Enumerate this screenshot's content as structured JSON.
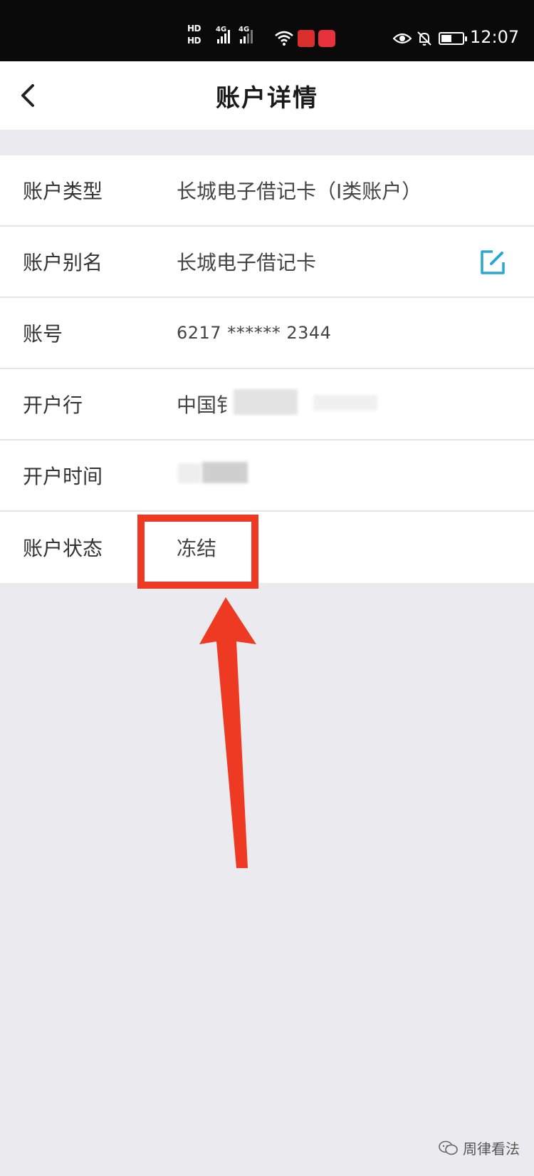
{
  "status_bar": {
    "network_label_1": "HD",
    "network_label_2": "HD",
    "signal_tag_1": "4G",
    "signal_tag_2": "4G",
    "time": "12:07"
  },
  "header": {
    "title": "账户详情",
    "back_icon": "chevron-left-icon"
  },
  "details": {
    "rows": [
      {
        "label": "账户类型",
        "value": "长城电子借记卡（I类账户）"
      },
      {
        "label": "账户别名",
        "value": "长城电子借记卡"
      },
      {
        "label": "账号",
        "value": "6217 ****** 2344"
      },
      {
        "label": "开户行",
        "value": "中国钅"
      },
      {
        "label": "开户时间",
        "value": ""
      },
      {
        "label": "账户状态",
        "value": "冻结"
      }
    ]
  },
  "icons": {
    "edit": "edit-icon"
  },
  "colors": {
    "accent": "#2aa7d9",
    "annotation": "#ee3a22",
    "background": "#ebebef"
  },
  "watermark": {
    "text": "周律看法"
  }
}
